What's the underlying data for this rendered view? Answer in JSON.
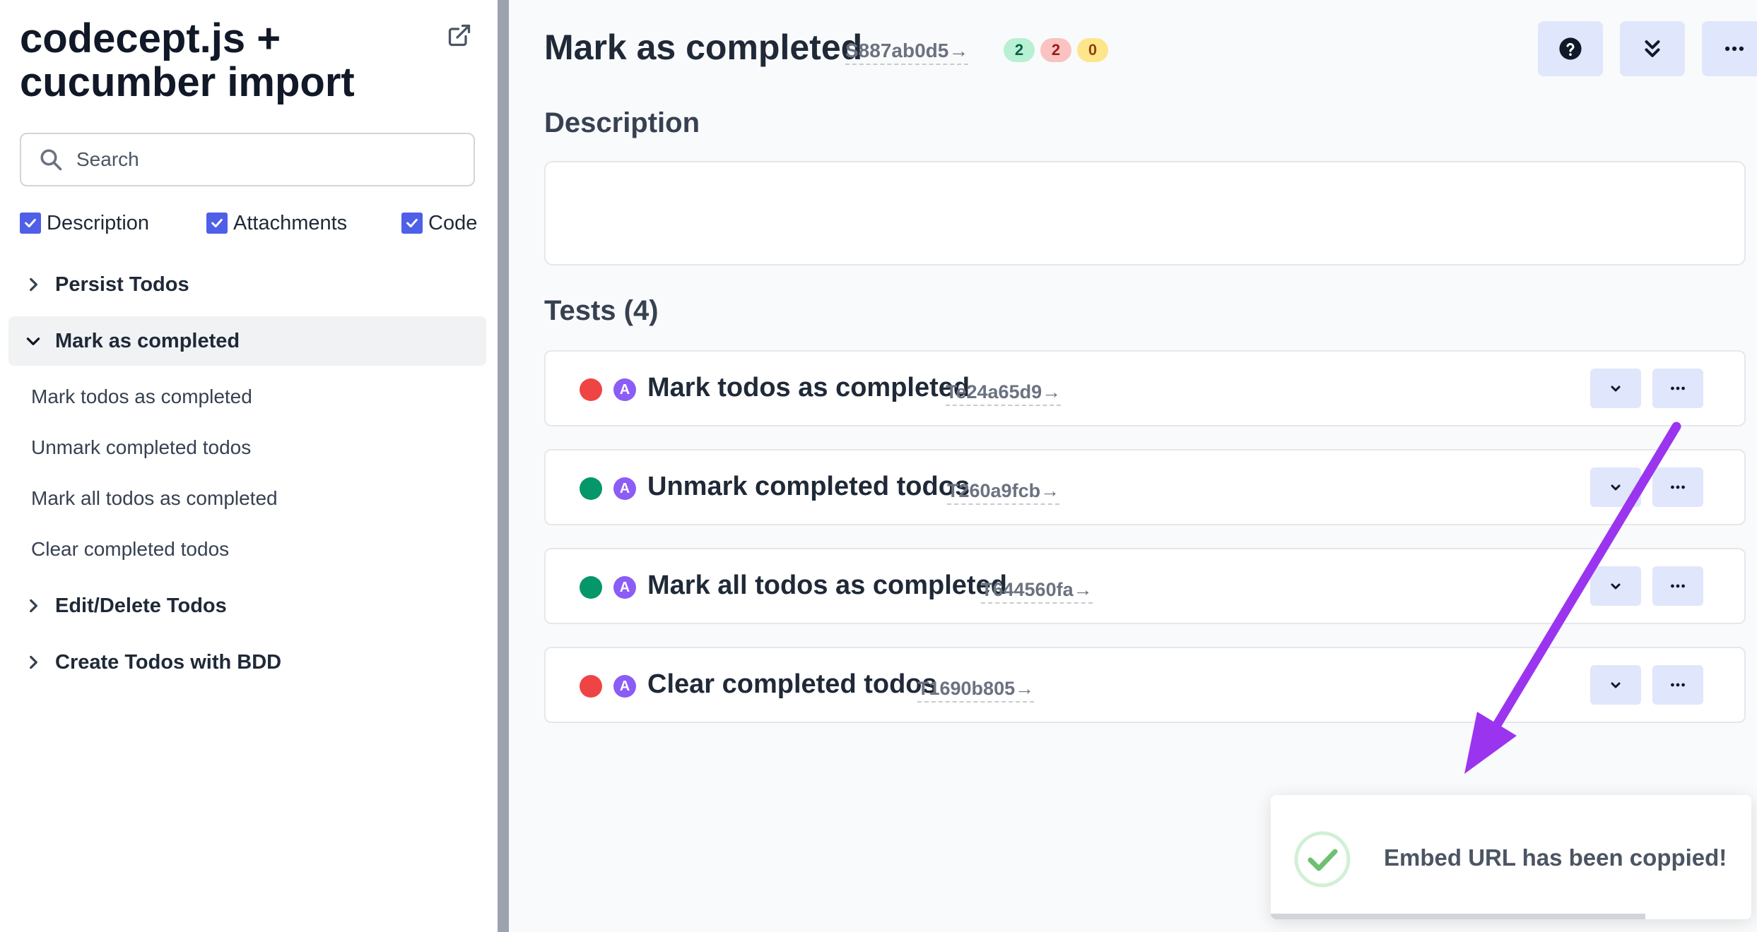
{
  "sidebar": {
    "title_line1": "codecept.js +",
    "title_line2": "cucumber import",
    "search_placeholder": "Search",
    "filters": [
      {
        "label": "Description",
        "checked": true
      },
      {
        "label": "Attachments",
        "checked": true
      },
      {
        "label": "Code",
        "checked": true
      }
    ],
    "groups": [
      {
        "label": "Persist Todos",
        "expanded": false
      },
      {
        "label": "Mark as completed",
        "expanded": true,
        "active": true,
        "items": [
          "Mark todos as completed",
          "Unmark completed todos",
          "Mark all todos as completed",
          "Clear completed todos"
        ]
      },
      {
        "label": "Edit/Delete Todos",
        "expanded": false
      },
      {
        "label": "Create Todos with BDD",
        "expanded": false
      }
    ]
  },
  "header": {
    "title": "Mark as completed",
    "suite_id": "S887ab0d5→",
    "badges": {
      "passed": "2",
      "failed": "2",
      "skipped": "0"
    },
    "buttons": [
      "help-icon",
      "collapse-all-icon",
      "more-icon"
    ]
  },
  "description": {
    "heading": "Description",
    "content": ""
  },
  "tests": {
    "heading": "Tests (4)",
    "items": [
      {
        "title": "Mark todos as completed",
        "id": "Te24a65d9→",
        "status": "failed",
        "auto": "A"
      },
      {
        "title": "Unmark completed todos",
        "id": "T260a9fcb→",
        "status": "passed",
        "auto": "A"
      },
      {
        "title": "Mark all todos as completed",
        "id": "T644560fa→",
        "status": "passed",
        "auto": "A"
      },
      {
        "title": "Clear completed todos",
        "id": "T1690b805→",
        "status": "failed",
        "auto": "A"
      }
    ]
  },
  "toast": {
    "message": "Embed URL has been coppied!",
    "progress": 0.78
  },
  "colors": {
    "accent": "#4f5fe8",
    "passed": "#059669",
    "failed": "#ef4444",
    "auto": "#8b5cf6",
    "annotation_arrow": "#9b34ef"
  }
}
